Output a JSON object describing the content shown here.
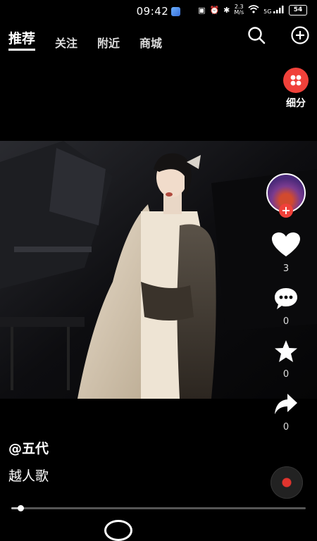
{
  "status": {
    "time": "09:42",
    "speed_top": "2.3",
    "speed_bottom": "M/s",
    "signal": "5G",
    "battery": "54"
  },
  "nav": {
    "tabs": [
      {
        "label": "推荐",
        "active": true
      },
      {
        "label": "关注"
      },
      {
        "label": "附近"
      },
      {
        "label": "商城"
      }
    ]
  },
  "xifen": {
    "label": "细分"
  },
  "actions": {
    "like_count": "3",
    "comment_count": "0",
    "favorite_count": "0",
    "share_count": "0"
  },
  "video": {
    "author": "@五代",
    "description": "越人歌"
  },
  "progress": {
    "fraction": 0.03
  },
  "colors": {
    "accent_red": "#f0413a",
    "background": "#000000"
  }
}
